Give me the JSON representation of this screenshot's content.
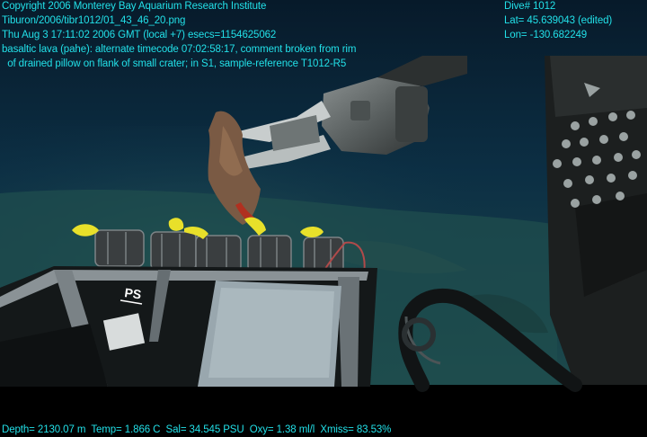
{
  "overlay": {
    "top_left": [
      "Copyright 2006 Monterey Bay Aquarium Research Institute",
      "Tiburon/2006/tibr1012/01_43_46_20.png",
      "Thu Aug  3 17:11:02 2006 GMT (local +7)  esecs=1154625062",
      "basaltic lava (pahe): alternate timecode 07:02:58:17, comment broken from rim",
      "  of drained pillow on flank of small crater; in S1, sample-reference T1012-R5"
    ],
    "top_right": [
      "Dive# 1012",
      "Lat= 45.639043 (edited)",
      "Lon= -130.682249"
    ],
    "bottom_left": "Depth= 2130.07 m  Temp= 1.866 C  Sal= 34.545 PSU  Oxy= 1.38 ml/l  Xmiss= 83.53%"
  },
  "scene": {
    "basket_marking": "PS",
    "colors": {
      "water_deep": "#0b2a3e",
      "seafloor": "#1e4a4a",
      "overlay_text": "#22e0e8",
      "rope": "#e8e02a"
    }
  }
}
